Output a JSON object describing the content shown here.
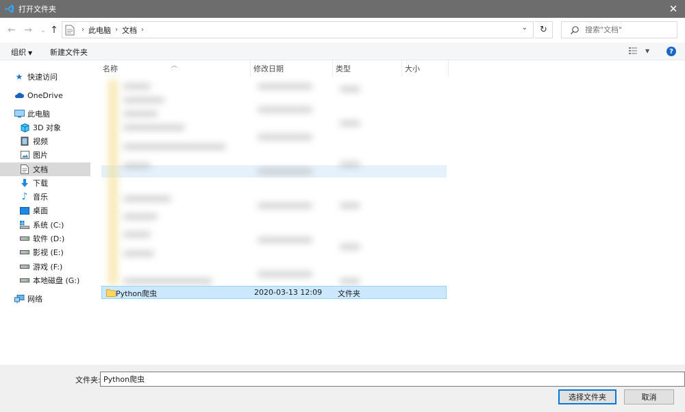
{
  "window": {
    "title": "打开文件夹",
    "close_glyph": "✕"
  },
  "nav": {
    "back_glyph": "←",
    "forward_glyph": "→",
    "recent_glyph": "⌄",
    "up_glyph": "↑",
    "breadcrumb": [
      "此电脑",
      "文档"
    ],
    "refresh_glyph": "↻",
    "search_placeholder": "搜索\"文档\""
  },
  "toolbar": {
    "organize": "组织",
    "new_folder": "新建文件夹"
  },
  "sidebar": {
    "items": [
      {
        "label": "快速访问",
        "icon": "star-icon"
      },
      {
        "label": "OneDrive",
        "icon": "cloud-icon"
      },
      {
        "label": "此电脑",
        "icon": "computer-icon"
      },
      {
        "label": "3D 对象",
        "icon": "cube-icon"
      },
      {
        "label": "视频",
        "icon": "video-icon"
      },
      {
        "label": "图片",
        "icon": "picture-icon"
      },
      {
        "label": "文档",
        "icon": "document-icon",
        "selected": true
      },
      {
        "label": "下载",
        "icon": "download-icon"
      },
      {
        "label": "音乐",
        "icon": "music-icon"
      },
      {
        "label": "桌面",
        "icon": "desktop-icon"
      },
      {
        "label": "系统 (C:)",
        "icon": "system-drive-icon"
      },
      {
        "label": "软件 (D:)",
        "icon": "drive-icon"
      },
      {
        "label": "影视 (E:)",
        "icon": "drive-icon"
      },
      {
        "label": "游戏 (F:)",
        "icon": "drive-icon"
      },
      {
        "label": "本地磁盘 (G:)",
        "icon": "drive-icon"
      },
      {
        "label": "网络",
        "icon": "network-icon"
      }
    ]
  },
  "list": {
    "columns": [
      "名称",
      "修改日期",
      "类型",
      "大小"
    ],
    "selected_row": {
      "name": "Python爬虫",
      "date": "2020-03-13 12:09",
      "type": "文件夹",
      "size": ""
    }
  },
  "bottom": {
    "folder_label": "文件夹:",
    "folder_value": "Python爬虫",
    "select_button": "选择文件夹",
    "cancel_button": "取消"
  },
  "colors": {
    "accent": "#0078d7",
    "selection": "#cce8ff",
    "titlebar": "#6d6d6d"
  }
}
